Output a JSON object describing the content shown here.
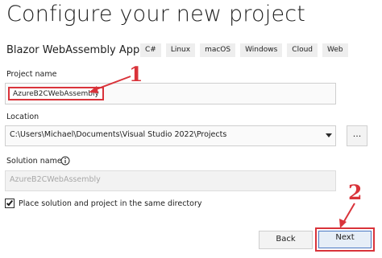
{
  "header": {
    "title": "Configure your new project",
    "template_name": "Blazor WebAssembly App",
    "tags": [
      "C#",
      "Linux",
      "macOS",
      "Windows",
      "Cloud",
      "Web"
    ]
  },
  "project_name": {
    "label": "Project name",
    "value": "AzureB2CWebAssembly"
  },
  "location": {
    "label": "Location",
    "value": "C:\\Users\\Michael\\Documents\\Visual Studio 2022\\Projects",
    "browse_label": "..."
  },
  "solution_name": {
    "label": "Solution name",
    "info_icon": "info-icon",
    "placeholder": "AzureB2CWebAssembly"
  },
  "same_directory": {
    "label": "Place solution and project in the same directory",
    "checked": true
  },
  "buttons": {
    "back_label": "Back",
    "next_label": "Next"
  },
  "annotations": {
    "step1": "1",
    "step2": "2",
    "color": "#d9333a"
  }
}
